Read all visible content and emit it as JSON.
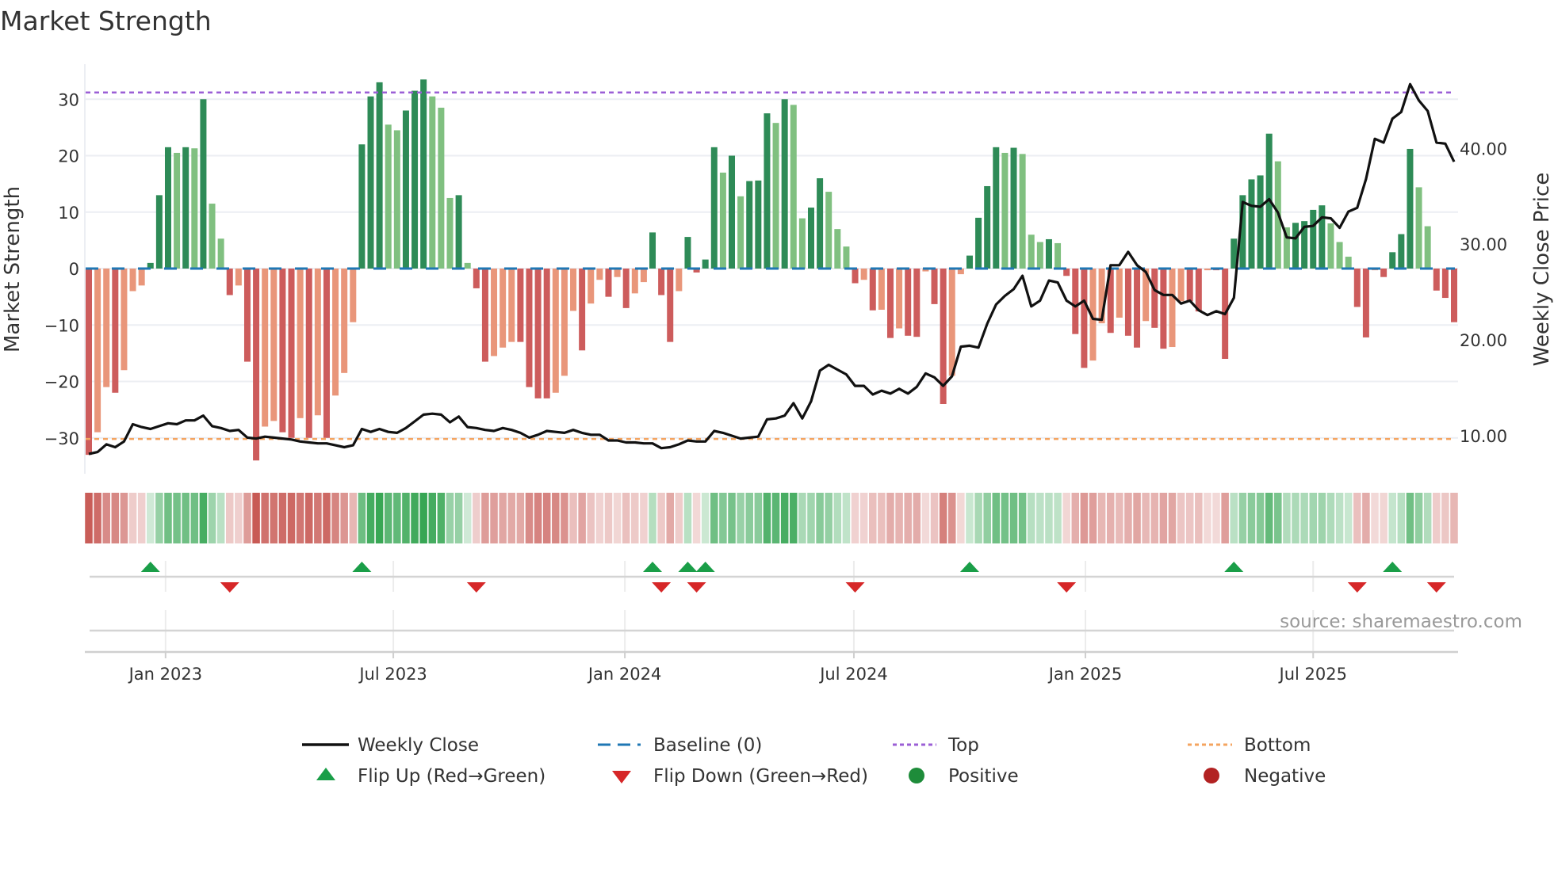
{
  "chart_data": {
    "type": "bar",
    "title": "Market Strength",
    "ylabel": "Market Strength",
    "y2label": "Weekly Close Price",
    "frequency": "weekly",
    "start_week": "2022-11-01",
    "ylim": [
      -36.3,
      36
    ],
    "y2lim": [
      6.1,
      48.8
    ],
    "yticks": [
      -30,
      -20,
      -10,
      0,
      10,
      20,
      30
    ],
    "ytick_labels": [
      "−30",
      "−20",
      "−10",
      "0",
      "10",
      "20",
      "30"
    ],
    "y2ticks": [
      10,
      20,
      30,
      40
    ],
    "y2tick_labels": [
      "10.00",
      "20.00",
      "30.00",
      "40.00"
    ],
    "xticks": [
      {
        "label": "Jan 2023",
        "date": "2023-01-01"
      },
      {
        "label": "Jul 2023",
        "date": "2023-07-01"
      },
      {
        "label": "Jan 2024",
        "date": "2024-01-01"
      },
      {
        "label": "Jul 2024",
        "date": "2024-07-01"
      },
      {
        "label": "Jan 2025",
        "date": "2025-01-01"
      },
      {
        "label": "Jul 2025",
        "date": "2025-07-01"
      }
    ],
    "top_level": 31.2,
    "bottom_level": -30.2,
    "baseline": 0,
    "strength": [
      -33,
      -29,
      -21,
      -22,
      -18,
      -4,
      -3,
      1,
      13,
      21.5,
      20.5,
      21.5,
      21.3,
      30,
      11.5,
      5.3,
      -4.7,
      -3,
      -16.5,
      -34,
      -28,
      -27,
      -29,
      -30,
      -26.5,
      -30,
      -26,
      -30,
      -22.5,
      -18.5,
      -9.5,
      22,
      30.5,
      33,
      25.5,
      24.5,
      28,
      31.5,
      33.5,
      30.5,
      28.5,
      12.5,
      13,
      1,
      -3.5,
      -16.5,
      -15.5,
      -14,
      -13,
      -13,
      -21,
      -23,
      -23,
      -22,
      -19,
      -7.5,
      -14.5,
      -6.2,
      -2,
      -5,
      -1.5,
      -7,
      -4.4,
      -2.4,
      6.4,
      -4.7,
      -13,
      -4,
      5.6,
      -0.7,
      1.6,
      21.5,
      17,
      20,
      12.8,
      15.5,
      15.6,
      27.5,
      25.8,
      30,
      29,
      8.9,
      10.8,
      16,
      13.6,
      7,
      3.9,
      -2.6,
      -2,
      -7.4,
      -7.3,
      -12.3,
      -10.6,
      -11.9,
      -12.1,
      -0.5,
      -6.3,
      -24,
      -19,
      -1,
      2.3,
      9,
      14.6,
      21.5,
      20.5,
      21.4,
      20.3,
      6,
      4.7,
      5.2,
      4.5,
      -1.3,
      -11.6,
      -17.6,
      -16.3,
      -9.7,
      -11.4,
      -8.7,
      -11.9,
      -14,
      -9.3,
      -10.5,
      -14.2,
      -13.9,
      -5.8,
      -5.8,
      -7.6,
      -0.3,
      -0.3,
      -16,
      5.3,
      13,
      15.8,
      16.5,
      23.9,
      19,
      7.3,
      8.1,
      8.4,
      10.4,
      11.2,
      8,
      4.7,
      2.1,
      -6.8,
      -12.2,
      -0.3,
      -1.5,
      2.9,
      6.1,
      21.2,
      14.4,
      7.5,
      -3.9,
      -5.2,
      -9.5
    ],
    "weekly_close": [
      8.1,
      8.3,
      9.1,
      8.8,
      9.4,
      11.2,
      10.9,
      10.7,
      11.0,
      11.3,
      11.2,
      11.6,
      11.6,
      12.1,
      11.0,
      10.8,
      10.5,
      10.6,
      9.8,
      9.7,
      9.9,
      9.8,
      9.7,
      9.6,
      9.4,
      9.3,
      9.2,
      9.2,
      9.0,
      8.8,
      9.0,
      10.7,
      10.4,
      10.7,
      10.4,
      10.3,
      10.8,
      11.5,
      12.2,
      12.3,
      12.2,
      11.4,
      12.0,
      10.9,
      10.8,
      10.6,
      10.5,
      10.8,
      10.6,
      10.3,
      9.8,
      10.1,
      10.5,
      10.4,
      10.3,
      10.6,
      10.3,
      10.1,
      10.1,
      9.5,
      9.5,
      9.3,
      9.3,
      9.2,
      9.2,
      8.7,
      8.8,
      9.1,
      9.5,
      9.4,
      9.4,
      10.5,
      10.3,
      10.0,
      9.7,
      9.8,
      9.9,
      11.7,
      11.8,
      12.1,
      13.4,
      11.8,
      13.6,
      16.8,
      17.4,
      16.9,
      16.4,
      15.2,
      15.2,
      14.3,
      14.7,
      14.4,
      14.9,
      14.4,
      15.1,
      16.5,
      16.1,
      15.2,
      16.2,
      19.3,
      19.4,
      19.2,
      21.7,
      23.7,
      24.6,
      25.3,
      26.7,
      23.5,
      24.1,
      26.2,
      26.0,
      24.1,
      23.5,
      24.1,
      22.2,
      22.1,
      27.8,
      27.8,
      29.2,
      27.8,
      27.1,
      25.2,
      24.7,
      24.7,
      23.8,
      24.1,
      23.1,
      22.6,
      23.0,
      22.7,
      24.4,
      34.4,
      34.0,
      33.9,
      34.7,
      33.3,
      30.7,
      30.6,
      31.8,
      31.9,
      32.8,
      32.7,
      31.7,
      33.4,
      33.8,
      36.8,
      41.0,
      40.6,
      43.1,
      43.8,
      46.7,
      45.0,
      43.9,
      40.6,
      40.5,
      38.6
    ],
    "legend": {
      "weekly_close": "Weekly Close",
      "baseline": "Baseline (0)",
      "top": "Top",
      "bottom": "Bottom",
      "flip_up": "Flip Up (Red→Green)",
      "flip_down": "Flip Down (Green→Red)",
      "positive": "Positive",
      "negative": "Negative"
    },
    "legend_placement": "bottom"
  },
  "source": "source: sharemaestro.com",
  "colors": {
    "green_dark": "#2e8b57",
    "green_light": "#80c080",
    "red_dark": "#cd5c5c",
    "red_light": "#e9967a",
    "strip_green": "#35a552",
    "strip_red": "#c85a55",
    "top": "#9b5fd6",
    "bottom": "#f4a460",
    "baseline": "#1f77b4",
    "price": "#111111",
    "flip_up": "#1a9e48",
    "flip_down": "#d62728",
    "positive": "#1e8c3a",
    "negative": "#b22222"
  }
}
